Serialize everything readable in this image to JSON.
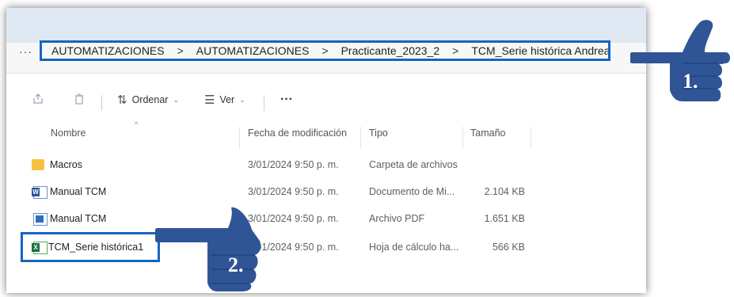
{
  "breadcrumb": {
    "more_label": "···",
    "segments": [
      "AUTOMATIZACIONES",
      "AUTOMATIZACIONES",
      "Practicante_2023_2",
      "TCM_Serie histórica Andrea"
    ],
    "separator": ">"
  },
  "toolbar": {
    "share_icon": "share-icon",
    "delete_icon": "trash-icon",
    "sort_label": "Ordenar",
    "view_label": "Ver",
    "more_label": "···"
  },
  "columns": {
    "name": "Nombre",
    "modified": "Fecha de modificación",
    "type": "Tipo",
    "size": "Tamaño"
  },
  "files": [
    {
      "name": "Macros",
      "modified": "3/01/2024 9:50 p. m.",
      "type": "Carpeta de archivos",
      "size": "",
      "icon": "folder-icon"
    },
    {
      "name": "Manual TCM",
      "modified": "3/01/2024 9:50 p. m.",
      "type": "Documento de Mi...",
      "size": "2.104 KB",
      "icon": "word-file-icon"
    },
    {
      "name": "Manual TCM",
      "modified": "3/01/2024 9:50 p. m.",
      "type": "Archivo PDF",
      "size": "1.651 KB",
      "icon": "pdf-file-icon"
    },
    {
      "name": "TCM_Serie histórica1",
      "modified": "3/01/2024 9:50 p. m.",
      "type": "Hoja de cálculo ha...",
      "size": "566 KB",
      "icon": "excel-file-icon"
    }
  ],
  "annotations": {
    "hand1_label": "1.",
    "hand2_label": "2."
  },
  "colors": {
    "highlight": "#1565c0",
    "hand": "#2f5597"
  }
}
